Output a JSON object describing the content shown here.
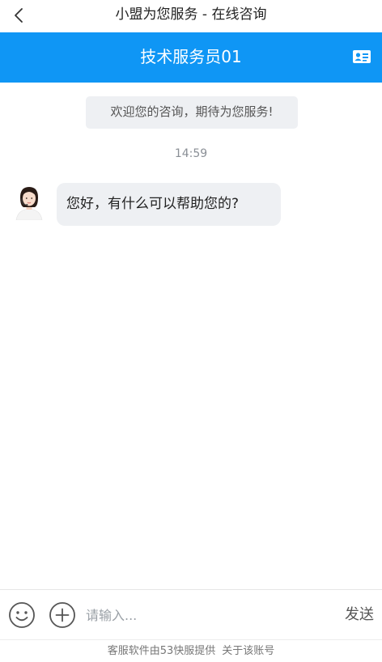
{
  "topnav": {
    "title": "小盟为您服务 - 在线咨询",
    "back_icon": "chevron-left-icon"
  },
  "agent_header": {
    "name": "技术服务员01",
    "background": "#0f96f5",
    "card_icon": "contact-card-icon"
  },
  "chat": {
    "system_message": "欢迎您的咨询，期待为您服务!",
    "timestamp": "14:59",
    "messages": [
      {
        "sender": "agent",
        "avatar_icon": "agent-avatar-icon",
        "text": "您好，有什么可以帮助您的?"
      }
    ]
  },
  "input_bar": {
    "emoji_icon": "emoji-icon",
    "plus_icon": "plus-circle-icon",
    "placeholder": "请输入...",
    "value": "",
    "send_label": "发送"
  },
  "footer": {
    "powered_by": "客服软件由53快服提供",
    "about_link": "关于该账号"
  }
}
